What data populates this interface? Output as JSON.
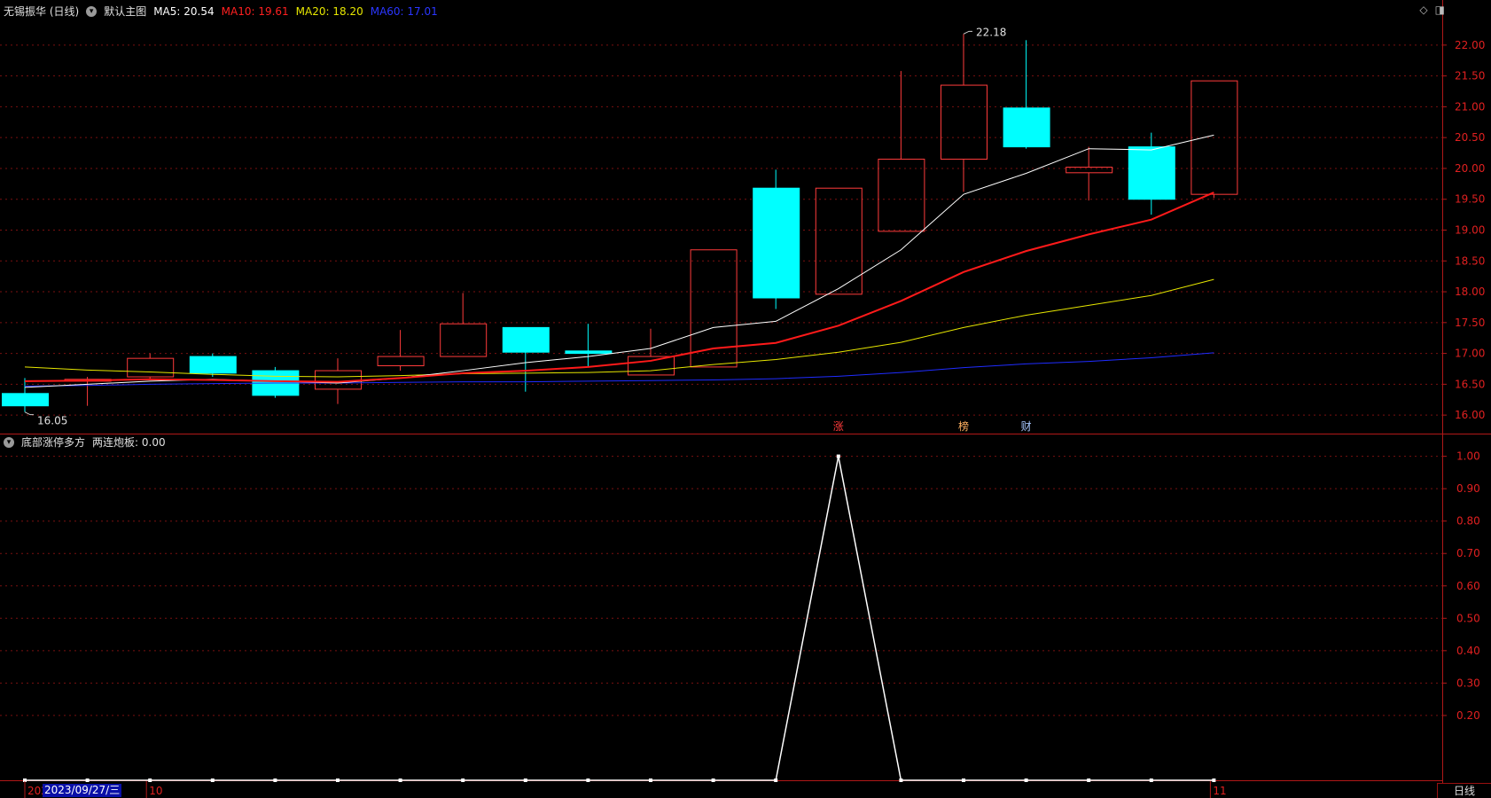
{
  "main_header": {
    "stock": "无锡振华 (日线)",
    "template": "默认主图",
    "ma5": "MA5: 20.54",
    "ma10": "MA10: 19.61",
    "ma20": "MA20: 18.20",
    "ma60": "MA60: 17.01"
  },
  "sub_header": {
    "indicator": "底部涨停多方",
    "value": "两连炮板: 0.00"
  },
  "colors": {
    "up": "#ff3b3b",
    "down": "#00ffff",
    "ma5": "#ffffff",
    "ma10": "#ff1a1a",
    "ma20": "#e6e600",
    "ma60": "#1f2cff",
    "axis_text": "#e02020",
    "grid": "#7a1010"
  },
  "icons": [
    "diamond-icon",
    "window-toggle-icon"
  ],
  "chart_data": [
    {
      "type": "candlestick",
      "ylim": [
        15.7,
        22.3
      ],
      "y_ticks": [
        "22.00",
        "21.50",
        "21.00",
        "20.50",
        "20.00",
        "19.50",
        "19.00",
        "18.50",
        "18.00",
        "17.50",
        "17.00",
        "16.50",
        "16.00"
      ],
      "candles": [
        {
          "o": 16.35,
          "h": 16.6,
          "l": 16.05,
          "c": 16.15
        },
        {
          "o": 16.55,
          "h": 16.62,
          "l": 16.15,
          "c": 16.58
        },
        {
          "o": 16.62,
          "h": 17.0,
          "l": 16.58,
          "c": 16.92
        },
        {
          "o": 16.95,
          "h": 17.0,
          "l": 16.62,
          "c": 16.68
        },
        {
          "o": 16.72,
          "h": 16.78,
          "l": 16.28,
          "c": 16.32
        },
        {
          "o": 16.42,
          "h": 16.92,
          "l": 16.18,
          "c": 16.72
        },
        {
          "o": 16.8,
          "h": 17.38,
          "l": 16.72,
          "c": 16.95
        },
        {
          "o": 16.95,
          "h": 17.98,
          "l": 16.95,
          "c": 17.48
        },
        {
          "o": 17.42,
          "h": 17.42,
          "l": 16.38,
          "c": 17.02
        },
        {
          "o": 17.04,
          "h": 17.48,
          "l": 16.78,
          "c": 17.0
        },
        {
          "o": 16.65,
          "h": 17.4,
          "l": 16.65,
          "c": 16.95
        },
        {
          "o": 16.78,
          "h": 18.68,
          "l": 16.78,
          "c": 18.68
        },
        {
          "o": 19.68,
          "h": 19.98,
          "l": 17.72,
          "c": 17.9
        },
        {
          "o": 17.96,
          "h": 19.68,
          "l": 17.96,
          "c": 19.68
        },
        {
          "o": 18.98,
          "h": 21.58,
          "l": 18.98,
          "c": 20.15
        },
        {
          "o": 20.15,
          "h": 22.18,
          "l": 19.62,
          "c": 21.35
        },
        {
          "o": 20.98,
          "h": 22.08,
          "l": 20.32,
          "c": 20.35
        },
        {
          "o": 19.93,
          "h": 20.35,
          "l": 19.48,
          "c": 20.02
        },
        {
          "o": 20.35,
          "h": 20.58,
          "l": 19.25,
          "c": 19.5
        },
        {
          "o": 19.58,
          "h": 21.42,
          "l": 19.52,
          "c": 21.42
        }
      ],
      "ma5": [
        16.45,
        16.5,
        16.55,
        16.58,
        16.55,
        16.52,
        16.6,
        16.72,
        16.85,
        16.95,
        17.08,
        17.42,
        17.52,
        18.05,
        18.68,
        19.58,
        19.92,
        20.32,
        20.3,
        20.54
      ],
      "ma10": [
        16.55,
        16.56,
        16.58,
        16.57,
        16.55,
        16.54,
        16.6,
        16.68,
        16.72,
        16.78,
        16.88,
        17.08,
        17.17,
        17.45,
        17.85,
        18.32,
        18.66,
        18.93,
        19.17,
        19.61
      ],
      "ma20": [
        16.78,
        16.73,
        16.7,
        16.66,
        16.63,
        16.62,
        16.64,
        16.67,
        16.68,
        16.69,
        16.72,
        16.82,
        16.9,
        17.02,
        17.18,
        17.42,
        17.62,
        17.78,
        17.94,
        18.2
      ],
      "ma60": [
        16.47,
        16.48,
        16.5,
        16.51,
        16.52,
        16.52,
        16.53,
        16.54,
        16.54,
        16.55,
        16.56,
        16.57,
        16.59,
        16.63,
        16.69,
        16.77,
        16.83,
        16.87,
        16.93,
        17.01
      ],
      "annotations": [
        {
          "label": "22.18",
          "index": 15,
          "price": 22.18
        },
        {
          "label": "16.05",
          "index": 0,
          "price": 16.05
        }
      ],
      "event_marks": [
        {
          "label": "涨",
          "index": 13,
          "color": "#ff3b3b"
        },
        {
          "label": "榜",
          "index": 15,
          "color": "#ffb060"
        },
        {
          "label": "财",
          "index": 16,
          "color": "#a8c8ff"
        }
      ]
    },
    {
      "type": "line",
      "ylim": [
        0,
        1.04
      ],
      "y_ticks": [
        "1.00",
        "0.90",
        "0.80",
        "0.70",
        "0.60",
        "0.50",
        "0.40",
        "0.30",
        "0.20"
      ],
      "values": [
        0,
        0,
        0,
        0,
        0,
        0,
        0,
        0,
        0,
        0,
        0,
        0,
        0,
        1,
        0,
        0,
        0,
        0,
        0,
        0
      ],
      "x_labels": [
        {
          "label": "202",
          "index": 0
        },
        {
          "label": "10",
          "index": 2
        },
        {
          "label": "11",
          "index": 19
        }
      ]
    }
  ],
  "footer": {
    "cursor_date": "2023/09/27/三",
    "period_tab": "日线"
  }
}
